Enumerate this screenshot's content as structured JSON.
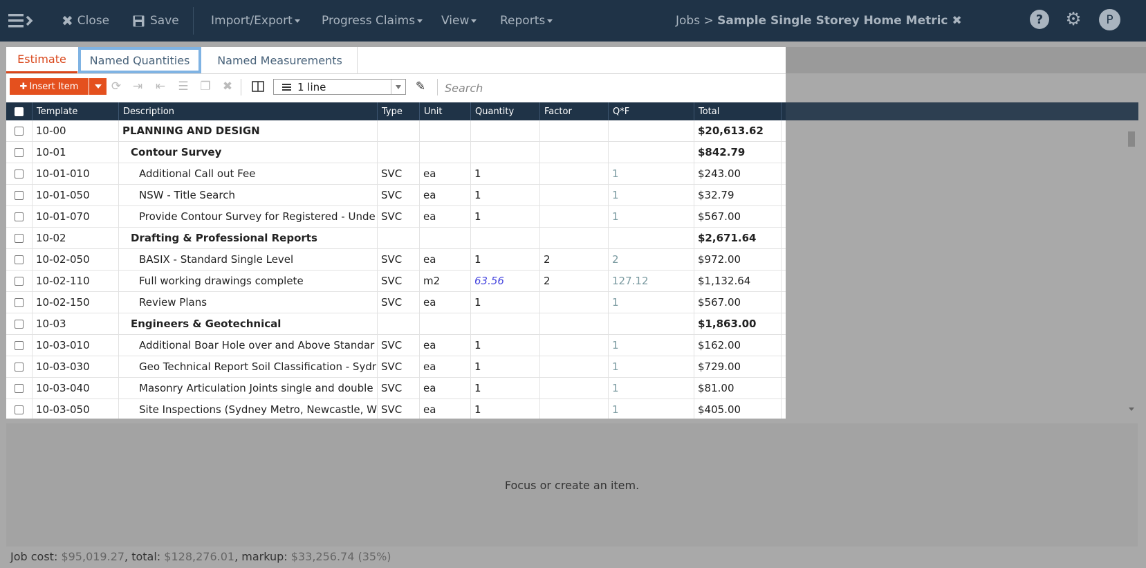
{
  "topbar": {
    "close_label": "Close",
    "save_label": "Save",
    "menus": [
      "Import/Export",
      "Progress Claims",
      "View",
      "Reports"
    ],
    "breadcrumb_prefix": "Jobs >",
    "job_title": "Sample Single Storey Home Metric",
    "avatar_letter": "P"
  },
  "tabs": [
    "Estimate",
    "Named Quantities",
    "Named Measurements"
  ],
  "toolbar": {
    "insert_label": "Insert Item",
    "lines_value": "1 line",
    "search_placeholder": "Search"
  },
  "columns": [
    "Template",
    "Description",
    "Type",
    "Unit",
    "Quantity",
    "Factor",
    "Q*F",
    "Total"
  ],
  "rows": [
    {
      "template": "10-00",
      "description": "PLANNING AND DESIGN",
      "type": "",
      "unit": "",
      "quantity": "",
      "factor": "",
      "qf": "",
      "total": "$20,613.62",
      "level": 0
    },
    {
      "template": "10-01",
      "description": "Contour Survey",
      "type": "",
      "unit": "",
      "quantity": "",
      "factor": "",
      "qf": "",
      "total": "$842.79",
      "level": 1
    },
    {
      "template": "10-01-010",
      "description": "Additional Call out Fee",
      "type": "SVC",
      "unit": "ea",
      "quantity": "1",
      "factor": "",
      "qf": "1",
      "total": "$243.00",
      "level": 2
    },
    {
      "template": "10-01-050",
      "description": "NSW - Title Search",
      "type": "SVC",
      "unit": "ea",
      "quantity": "1",
      "factor": "",
      "qf": "1",
      "total": "$32.79",
      "level": 2
    },
    {
      "template": "10-01-070",
      "description": "Provide Contour Survey for Registered - Unde",
      "type": "SVC",
      "unit": "ea",
      "quantity": "1",
      "factor": "",
      "qf": "1",
      "total": "$567.00",
      "level": 2
    },
    {
      "template": "10-02",
      "description": "Drafting & Professional Reports",
      "type": "",
      "unit": "",
      "quantity": "",
      "factor": "",
      "qf": "",
      "total": "$2,671.64",
      "level": 1
    },
    {
      "template": "10-02-050",
      "description": "BASIX - Standard Single Level",
      "type": "SVC",
      "unit": "ea",
      "quantity": "1",
      "factor": "2",
      "qf": "2",
      "total": "$972.00",
      "level": 2
    },
    {
      "template": "10-02-110",
      "description": "Full working drawings complete",
      "type": "SVC",
      "unit": "m2",
      "quantity": "63.56",
      "factor": "2",
      "qf": "127.12",
      "total": "$1,132.64",
      "level": 2,
      "named_qty": true
    },
    {
      "template": "10-02-150",
      "description": "Review Plans",
      "type": "SVC",
      "unit": "ea",
      "quantity": "1",
      "factor": "",
      "qf": "1",
      "total": "$567.00",
      "level": 2
    },
    {
      "template": "10-03",
      "description": "Engineers & Geotechnical",
      "type": "",
      "unit": "",
      "quantity": "",
      "factor": "",
      "qf": "",
      "total": "$1,863.00",
      "level": 1
    },
    {
      "template": "10-03-010",
      "description": "Additional Boar Hole over and Above Standar",
      "type": "SVC",
      "unit": "ea",
      "quantity": "1",
      "factor": "",
      "qf": "1",
      "total": "$162.00",
      "level": 2
    },
    {
      "template": "10-03-030",
      "description": "Geo Technical Report Soil Classification - Sydr",
      "type": "SVC",
      "unit": "ea",
      "quantity": "1",
      "factor": "",
      "qf": "1",
      "total": "$729.00",
      "level": 2
    },
    {
      "template": "10-03-040",
      "description": "Masonry Articulation Joints single and double",
      "type": "SVC",
      "unit": "ea",
      "quantity": "1",
      "factor": "",
      "qf": "1",
      "total": "$81.00",
      "level": 2
    },
    {
      "template": "10-03-050",
      "description": "Site Inspections (Sydney Metro, Newcastle, W",
      "type": "SVC",
      "unit": "ea",
      "quantity": "1",
      "factor": "",
      "qf": "1",
      "total": "$405.00",
      "level": 2
    }
  ],
  "detail_placeholder": "Focus or create an item.",
  "footer": {
    "job_cost_label": "Job cost:",
    "job_cost": "$95,019.27",
    "total_label": "total:",
    "total": "$128,276.01",
    "markup_label": "markup:",
    "markup": "$33,256.74 (35%)"
  }
}
